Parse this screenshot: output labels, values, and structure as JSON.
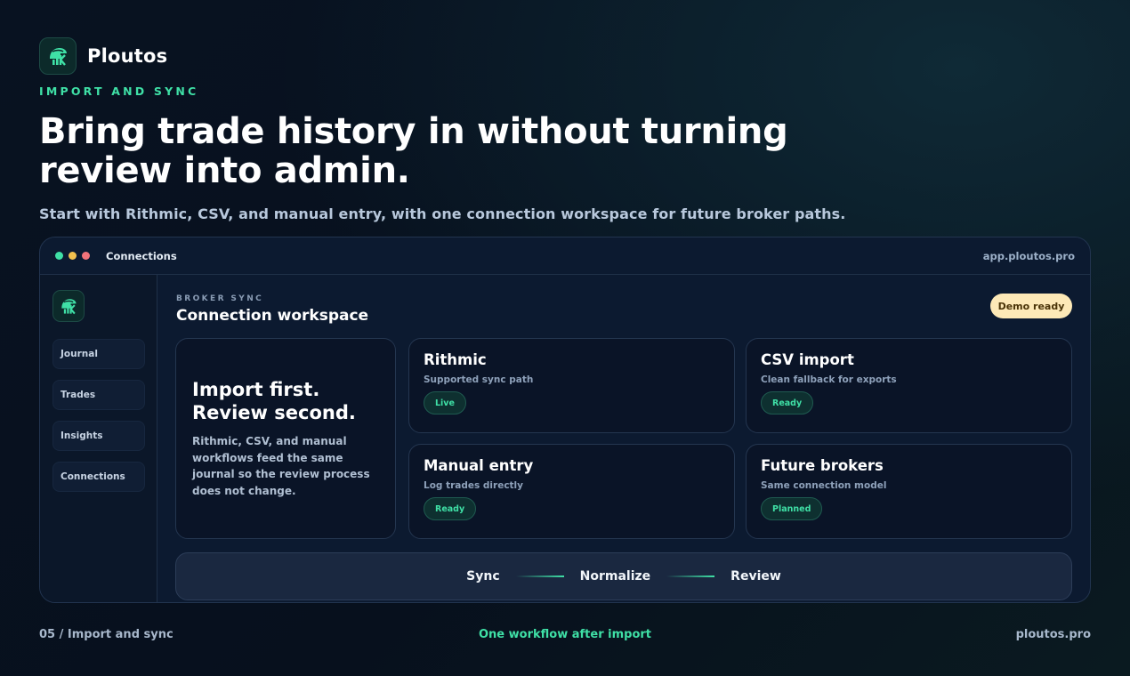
{
  "brand": {
    "name": "Ploutos"
  },
  "hero": {
    "eyebrow": "IMPORT AND SYNC",
    "headline": "Bring trade history in without turning review into admin.",
    "subline": "Start with Rithmic, CSV, and manual entry, with one connection workspace for future broker paths."
  },
  "window": {
    "title": "Connections",
    "url": "app.ploutos.pro",
    "dot_colors": [
      "#3fe0a6",
      "#f2c14e",
      "#f2737a"
    ]
  },
  "sidebar": {
    "items": [
      {
        "label": "Journal"
      },
      {
        "label": "Trades"
      },
      {
        "label": "Insights"
      },
      {
        "label": "Connections"
      }
    ]
  },
  "workspace": {
    "eyebrow": "BROKER SYNC",
    "title": "Connection workspace",
    "badge": "Demo ready",
    "feature": {
      "title_line1": "Import first.",
      "title_line2": "Review second.",
      "body": "Rithmic, CSV, and manual workflows feed the same journal so the review process does not change."
    },
    "cards": [
      {
        "title": "Rithmic",
        "subtitle": "Supported sync path",
        "status": "Live"
      },
      {
        "title": "CSV import",
        "subtitle": "Clean fallback for exports",
        "status": "Ready"
      },
      {
        "title": "Manual entry",
        "subtitle": "Log trades directly",
        "status": "Ready"
      },
      {
        "title": "Future brokers",
        "subtitle": "Same connection model",
        "status": "Planned"
      }
    ],
    "flow": [
      "Sync",
      "Normalize",
      "Review"
    ]
  },
  "footer": {
    "left": "05 / Import and sync",
    "center": "One workflow after import",
    "right": "ploutos.pro"
  },
  "colors": {
    "accent": "#3fe0a6",
    "badge_bg": "#fde9b7",
    "background": "#081221"
  },
  "icons": {
    "logo": "spartan-helmet-chart-icon"
  }
}
